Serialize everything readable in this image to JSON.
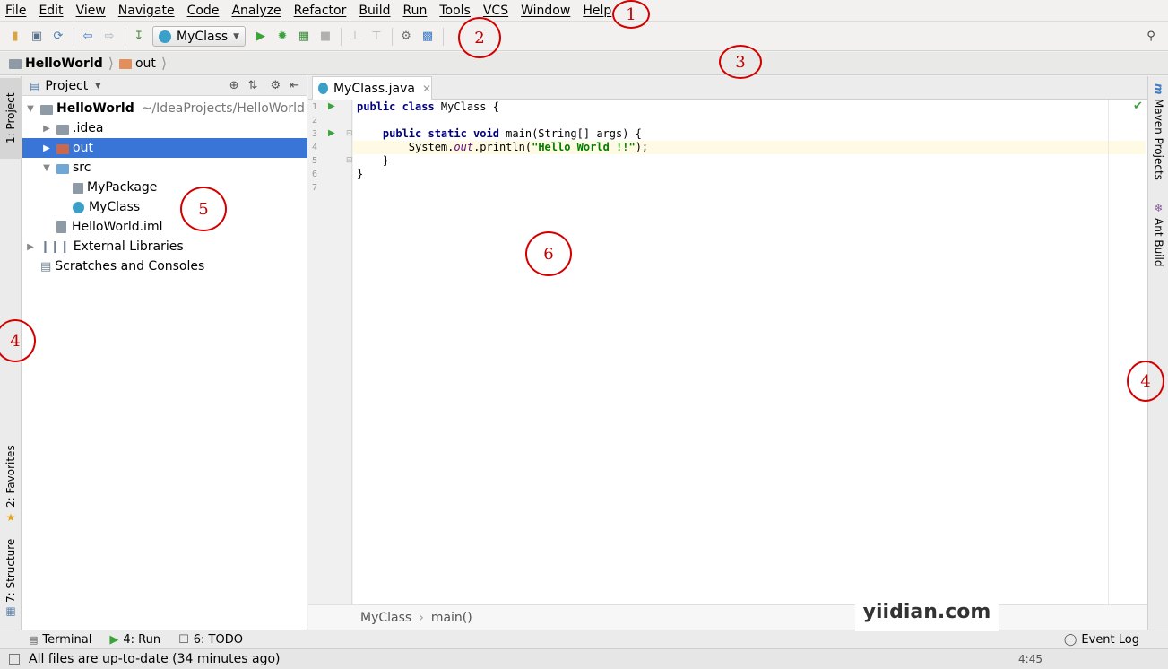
{
  "menu": [
    "File",
    "Edit",
    "View",
    "Navigate",
    "Code",
    "Analyze",
    "Refactor",
    "Build",
    "Run",
    "Tools",
    "VCS",
    "Window",
    "Help"
  ],
  "toolbar": {
    "run_config": "MyClass",
    "icons": [
      "open-folder-icon",
      "save-icon",
      "sync-icon",
      "back-icon",
      "forward-icon",
      "make-icon",
      "run-icon",
      "debug-icon",
      "coverage-icon",
      "stop-icon",
      "update-icon",
      "push-icon",
      "project-structure-icon",
      "sdk-icon",
      "search-icon"
    ]
  },
  "navbar": {
    "crumbs": [
      "HelloWorld",
      "out"
    ]
  },
  "left_tabs": {
    "project": "1: Project",
    "favorites": "2: Favorites",
    "structure": "7: Structure"
  },
  "right_tabs": {
    "maven": "Maven Projects",
    "ant": "Ant Build"
  },
  "project_panel": {
    "title": "Project",
    "tree": [
      {
        "label": "HelloWorld",
        "path": "~/IdeaProjects/HelloWorld",
        "depth": 0,
        "expanded": true
      },
      {
        "label": ".idea",
        "depth": 1,
        "expanded": false
      },
      {
        "label": "out",
        "depth": 1,
        "expanded": false,
        "selected": true
      },
      {
        "label": "src",
        "depth": 1,
        "expanded": true
      },
      {
        "label": "MyPackage",
        "depth": 2
      },
      {
        "label": "MyClass",
        "depth": 2
      },
      {
        "label": "HelloWorld.iml",
        "depth": 1
      },
      {
        "label": "External Libraries",
        "depth": 0,
        "expanded": false
      },
      {
        "label": "Scratches and Consoles",
        "depth": 0
      }
    ]
  },
  "editor": {
    "tab_label": "MyClass.java",
    "line_numbers": [
      "1",
      "2",
      "3",
      "4",
      "5",
      "6",
      "7"
    ],
    "lines": [
      "public class MyClass {",
      "",
      "    public static void main(String[] args) {",
      "        System.out.println(\"Hello World !!\");",
      "    }",
      "}",
      ""
    ],
    "breadcrumb": [
      "MyClass",
      "main()"
    ]
  },
  "bottom_tabs": {
    "terminal": "Terminal",
    "run": "4: Run",
    "todo": "6: TODO",
    "event_log": "Event Log"
  },
  "status": {
    "message": "All files are up-to-date (34 minutes ago)",
    "position": "4:45"
  },
  "annotations": [
    "1",
    "2",
    "3",
    "4",
    "5",
    "6",
    "4"
  ],
  "watermark": "yiidian.com",
  "colors": {
    "selection": "#3875d7",
    "keyword": "#000080",
    "string": "#008000",
    "annotation": "#d40000"
  }
}
